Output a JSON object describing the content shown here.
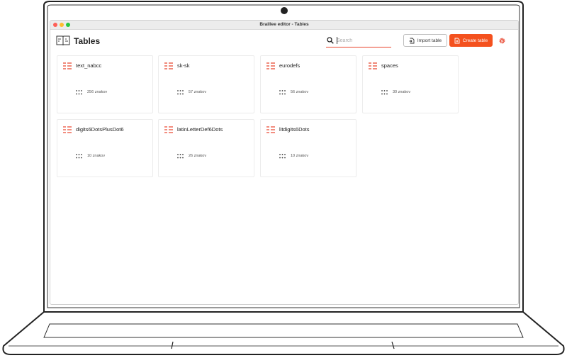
{
  "window": {
    "title": "Braillee editor - Tables"
  },
  "header": {
    "title": "Tables"
  },
  "search": {
    "placeholder": "Search"
  },
  "buttons": {
    "import_label": "Import table",
    "create_label": "Create table"
  },
  "colors": {
    "accent": "#f4511e",
    "search_underline": "#e8432c"
  },
  "icons": {
    "header": "book-icon",
    "search": "search-icon",
    "import": "file-import-icon",
    "create": "file-add-icon",
    "settings": "gear-icon",
    "card": "table-lines-icon",
    "count": "braille-dots-icon"
  },
  "tables": [
    {
      "name": "text_nabcc",
      "count": "256 znakov"
    },
    {
      "name": "sk-sk",
      "count": "57 znakov"
    },
    {
      "name": "eurodefs",
      "count": "56 znakov"
    },
    {
      "name": "spaces",
      "count": "30 znakov"
    },
    {
      "name": "digits6DotsPlusDot6",
      "count": "10 znakov"
    },
    {
      "name": "latinLetterDef6Dots",
      "count": "26 znakov"
    },
    {
      "name": "litdigits6Dots",
      "count": "10 znakov"
    }
  ]
}
